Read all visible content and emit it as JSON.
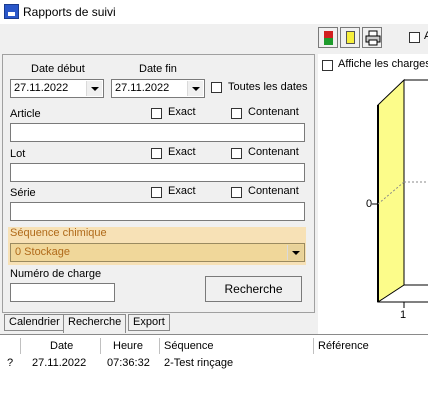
{
  "window": {
    "title": "Rapports de suivi"
  },
  "toolbar": {
    "buttons": [
      {
        "name": "color-icon-1",
        "colors": [
          "#d11f1f",
          "#1e9b2c"
        ]
      },
      {
        "name": "yellow-square-icon",
        "colors": [
          "#f7ef3b"
        ]
      },
      {
        "name": "printer-icon"
      }
    ],
    "check_label": "A"
  },
  "form": {
    "date_start_label": "Date début",
    "date_start_value": "27.11.2022",
    "date_end_label": "Date fin",
    "date_end_value": "27.11.2022",
    "all_dates_label": "Toutes les dates",
    "article_label": "Article",
    "lot_label": "Lot",
    "serie_label": "Série",
    "exact_label": "Exact",
    "contenant_label": "Contenant",
    "sequence_label": "Séquence chimique",
    "sequence_value": "0 Stockage",
    "charge_label": "Numéro de charge",
    "search_button": "Recherche"
  },
  "tabs": [
    "Calendrier",
    "Recherche",
    "Export"
  ],
  "chart": {
    "show_charges_label": "Affiche les charges",
    "y_tick": "0",
    "x_tick": "1",
    "fill": "#fcfc8a"
  },
  "table": {
    "columns": [
      "",
      "Date",
      "Heure",
      "Séquence",
      "Référence"
    ],
    "rows": [
      {
        "flag": "?",
        "date": "27.11.2022",
        "time": "07:36:32",
        "sequence": "2-Test rinçage",
        "reference": ""
      }
    ]
  }
}
